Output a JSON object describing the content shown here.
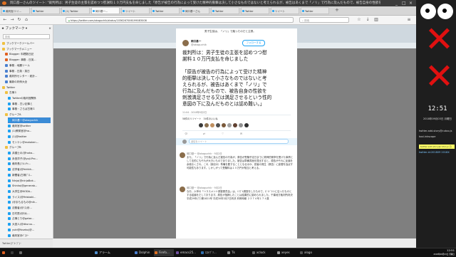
{
  "window": {
    "title": "岡口基一さんのツイート: \"裁判所は：男子生徒の主張を認めつつ慰謝料１０万円支払を命じました「原告が被告の行為によって受けた精神的衝撃は決して小さなものではないと考えられるが、被告はあくまで「ノリ」で行為に及んだもので、被告自身の性欲を刺激満足させる又は満足させるという性的意図の下に及んだものとは認め難い。」\" - Mozilla Firefox",
    "controls": [
      "_",
      "□",
      "×"
    ]
  },
  "tabs": [
    {
      "label": "裁判官/ツイ..."
    },
    {
      "label": "Twitter"
    },
    {
      "label": "(1) Twitter"
    },
    {
      "label": "岡口基一..."
    },
    {
      "label": "ツイート"
    },
    {
      "label": "Twitter"
    },
    {
      "label": "岡口基一さん"
    },
    {
      "label": "Twitter"
    },
    {
      "label": "Twitter"
    },
    {
      "label": "ツイート"
    },
    {
      "label": "Twitter"
    }
  ],
  "nav": {
    "url": "https://twitter.com/okaguchik/status/1036267006199083008",
    "search_placeholder": "検索"
  },
  "sidebar": {
    "title": "ブックマーク",
    "search_placeholder": "検索",
    "items": [
      {
        "label": "ブックマークツールバー",
        "color": "#f0c040"
      },
      {
        "label": "ブックマークメニュー",
        "color": "#f0c040"
      },
      {
        "label": "Blogger: 料理数日記",
        "color": "#e06020"
      },
      {
        "label": "Blogger: 事務 - 日英...",
        "color": "#e06020"
      },
      {
        "label": "事務 - 地震ツール",
        "color": "#4a80d0"
      },
      {
        "label": "事務 - 日英・英日",
        "color": "#4a80d0"
      },
      {
        "label": "裁判所センター・統計...",
        "color": "#4a80d0"
      },
      {
        "label": "最新の判例大全",
        "color": "#4a80d0"
      },
      {
        "label": "Twitter",
        "color": "#f0c040"
      },
      {
        "label": "古様１",
        "color": "#f0c040"
      },
      {
        "label": "Twitterの裁判官関係",
        "color": "#1da1f2"
      },
      {
        "label": "事務 - 古い記事と",
        "color": "#1da1f2"
      },
      {
        "label": "事務・さらば古様１",
        "color": "#1da1f2"
      },
      {
        "label": "グループA",
        "color": "#f0c040"
      },
      {
        "label": "岡口基一@okaguchik",
        "color": "#1da1f2"
      },
      {
        "label": "裁判官@twitter",
        "color": "#1da1f2"
      },
      {
        "label": "(1)教育官@ho...",
        "color": "#1da1f2"
      },
      {
        "label": "(1)@twitter",
        "color": "#1da1f2"
      },
      {
        "label": "モトケン@motoken...",
        "color": "#1da1f2"
      },
      {
        "label": "グループB",
        "color": "#f0c040"
      },
      {
        "label": "弁護士の(@hoka...",
        "color": "#1da1f2"
      },
      {
        "label": "永田洋子(@yoji.Pro...",
        "color": "#1da1f2"
      },
      {
        "label": "裁判長(ﾌﾗﾚﾝﾁｬ...",
        "color": "#1da1f2"
      },
      {
        "label": "法学者(@fnktkh...",
        "color": "#1da1f2"
      },
      {
        "label": "新聞者(古様ﾌﾟﾛ...",
        "color": "#1da1f2"
      },
      {
        "label": "Ninja(@ninjaBak...",
        "color": "#1da1f2"
      },
      {
        "label": "Shinko(@generab...",
        "color": "#1da1f2"
      },
      {
        "label": "大学生@NODA...",
        "color": "#1da1f2"
      },
      {
        "label": "ライス(@Yeisbaki...",
        "color": "#1da1f2"
      },
      {
        "label": "(@まもるもの@nik...",
        "color": "#1da1f2"
      },
      {
        "label": "法務者(@ﾐｽ)@...",
        "color": "#1da1f2"
      },
      {
        "label": "日村男(@ﾀｶﾋ...",
        "color": "#1da1f2"
      },
      {
        "label": "占様とり@gatar...",
        "color": "#1da1f2"
      },
      {
        "label": "大宮人(@dkuruu...",
        "color": "#1da1f2"
      },
      {
        "label": "yuki@fsveko(@...",
        "color": "#1da1f2"
      },
      {
        "label": "裁判官@ﾊﾞﾈﾘｰ",
        "color": "#1da1f2"
      },
      {
        "label": "事(判官@ﾉｰﾄﾎ...",
        "color": "#1da1f2"
      },
      {
        "label": "原 司(ﾊﾟﾌﾞ) @...",
        "color": "#1da1f2"
      }
    ],
    "footer": "Twitter(ｸﾞﾙｰﾌﾟ)ｰ"
  },
  "tweet": {
    "prev_text": "男子生徒は、「ノリ」で触ったのだと主張。",
    "author_name": "岡口基一",
    "author_handle": "@okaguchik",
    "follow_label": "フォローする",
    "line1": "裁判所は：男子生徒の主張を認めつつ慰",
    "line2": "謝料１０万円支払を命じました",
    "quote_lines": [
      "「原告が被告の行為によって受けた精神",
      "的衝撃は決して小さなものではないと考",
      "えられるが、被告はあくまで「ノリ」で",
      "行為に及んだもので、被告自身の性欲を",
      "刺激満足させる又は満足させるという性的",
      "意図の下に及んだものとは認め難い。」"
    ],
    "timestamp": "11:04 - 2018年9月2日",
    "stats": "58件のリツイート　34件のいいね",
    "reply_placeholder": "返信をツイート",
    "replies": [
      {
        "author": "岡口基一 @okaguchik · 9月2日",
        "text": "また、「ノリ」で行為に及んだ被告の行為が、原告が受験予定日までに精神的衝撃を受けた事情として法的にもそれが大きいものでありました。被告は準備書面を提出すると、原告がそれに反論を余儀なくされ、これ（訴訟の）準備を要することとなるほか、損害の発生（原告）に影響を及ぼす可能性もあります。しかしがって受験料は１０万円が相当と考える。"
      },
      {
        "author": "岡口基一 @okaguchik · 9月2日",
        "text": "なお、六甲の「ハラスメント調査委員会」は、ﾄﾗﾌﾞﾙ調査をしたもので、ｶﾞｲﾄﾞﾗｲﾝに沿ったものとする結論をだしております。原告が指摘したことは結果的に認められました。千葉地方裁判所判決平成29年(ワ)第1821号 平成30年3月7日判決 判例時報 ２３７４号１７４頁"
      }
    ]
  },
  "desktop": {
    "clock": "12:51",
    "date": "2018年09月03日 月曜日",
    "widget_lines": [
      "twitter-add-story@cutoo.js",
      "tool-inkscape",
      "twitter-id:201809 2018X"
    ],
    "notification": "twitter-add-story@cutoo.js 日"
  },
  "taskbar": {
    "tasks": [
      {
        "label": "",
        "color": "#e06020"
      },
      {
        "label": "",
        "color": "#3a3a3a"
      },
      {
        "label": "",
        "color": "#6a6a6a"
      },
      {
        "label": "アラーム",
        "color": "#5090d0"
      },
      {
        "label": "Dolphin",
        "color": "#4a80d0"
      },
      {
        "label": "Firefo...",
        "color": "#e07020"
      },
      {
        "label": "emacs25...",
        "color": "#7050a0"
      },
      {
        "label": "ｴｽﾃﾌﾞｿ...",
        "color": "#3070b0"
      },
      {
        "label": "Tk",
        "color": "#888888"
      },
      {
        "label": "xclock",
        "color": "#666666"
      },
      {
        "label": "xeyes",
        "color": "#999999"
      },
      {
        "label": "xlogo",
        "color": "#555555"
      }
    ],
    "time": "12:51",
    "date": "2018年09月03日 月曜日"
  }
}
